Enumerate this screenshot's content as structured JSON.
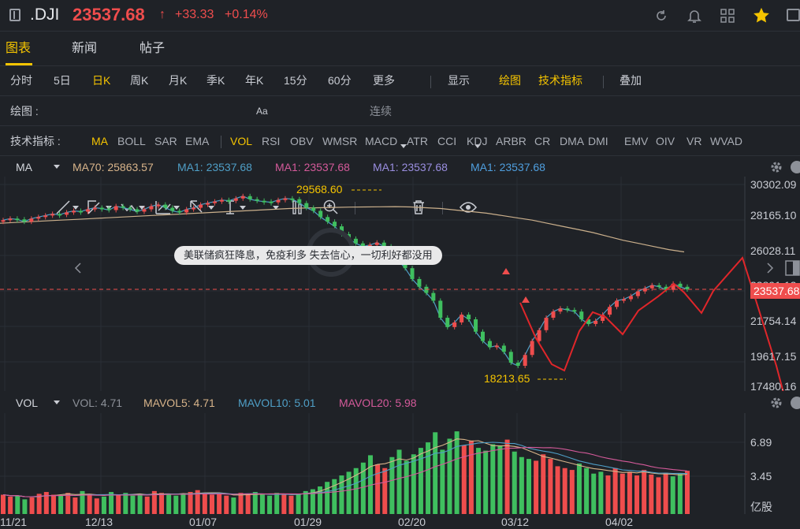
{
  "header": {
    "symbol": ".DJI",
    "price": "23537.68",
    "arrow": "↑",
    "change": "+33.33",
    "change_pct": "+0.14%",
    "icons": [
      "menu-icon",
      "refresh-icon",
      "bell-icon",
      "grid-icon",
      "star-icon",
      "more-icon"
    ]
  },
  "tabs": [
    "图表",
    "新闻",
    "帖子"
  ],
  "periods": [
    "分时",
    "5日",
    "日K",
    "周K",
    "月K",
    "季K",
    "年K",
    "15分",
    "60分",
    "更多"
  ],
  "period_right": [
    "显示",
    "绘图",
    "技术指标",
    "叠加"
  ],
  "drawbar": {
    "label": "绘图 :",
    "continuous": "连续"
  },
  "indicators": {
    "label": "技术指标 :",
    "items": [
      "MA",
      "BOLL",
      "SAR",
      "EMA",
      "VOL",
      "RSI",
      "OBV",
      "WMSR",
      "MACD",
      "ATR",
      "CCI",
      "KDJ",
      "ARBR",
      "CR",
      "DMA",
      "DMI",
      "EMV",
      "OIV",
      "VR",
      "WVAD"
    ]
  },
  "ma_legend": [
    "MA",
    "MA70: 25863.57",
    "MA1: 23537.68",
    "MA1: 23537.68",
    "MA1: 23537.68",
    "MA1: 23537.68"
  ],
  "vol_legend": [
    "VOL",
    "VOL: 4.71",
    "MAVOL5: 4.71",
    "MAVOL10: 5.01",
    "MAVOL20: 5.98"
  ],
  "price_axis": [
    "30302.09",
    "28165.10",
    "26028.11",
    "23891.12",
    "21754.14",
    "19617.15",
    "17480.16"
  ],
  "current_price_tag": "23537.68",
  "vol_axis": [
    "6.89",
    "3.45",
    "亿股"
  ],
  "dates": [
    "11/21",
    "12/13",
    "01/07",
    "01/29",
    "02/20",
    "03/12",
    "04/02"
  ],
  "annotations": {
    "high": "29568.60",
    "low": "18213.65",
    "comment": "美联储疯狂降息，免疫利多 失去信心，一切利好都没用"
  },
  "colors": {
    "up": "#ef4d4d",
    "down": "#3fbf5f",
    "gold": "#f5c400",
    "bg": "#1f2227"
  },
  "chart_data": {
    "type": "candlestick",
    "ylim": [
      17480.16,
      30302.09
    ],
    "x": [
      "11/21",
      "12/13",
      "01/07",
      "01/29",
      "02/20",
      "03/12",
      "04/02"
    ],
    "close_series": [
      28000,
      28100,
      28050,
      27900,
      28100,
      28200,
      28300,
      28400,
      28350,
      28500,
      28600,
      28550,
      28700,
      28800,
      28750,
      28650,
      28900,
      28800,
      28700,
      28550,
      28700,
      28900,
      29000,
      28800,
      28600,
      28500,
      28700,
      28800,
      29000,
      29100,
      29200,
      29300,
      29250,
      29400,
      29550,
      29350,
      29250,
      29200,
      29150,
      29300,
      29400,
      29350,
      29100,
      28800,
      28600,
      28200,
      27900,
      27600,
      27100,
      26800,
      26500,
      26300,
      26400,
      26550,
      26300,
      25800,
      25400,
      24900,
      24200,
      23700,
      23300,
      22800,
      21700,
      21100,
      21400,
      21900,
      21600,
      20800,
      20200,
      19800,
      19900,
      19500,
      18800,
      18600,
      19300,
      20200,
      20900,
      21700,
      22100,
      22300,
      22200,
      22100,
      21600,
      21300,
      21500,
      21900,
      22400,
      22800,
      22900,
      23100,
      23400,
      23600,
      23800,
      23700,
      23500,
      23900,
      23700,
      23537
    ],
    "ma70": [
      27800,
      27850,
      27900,
      27950,
      28000,
      28050,
      28100,
      28150,
      28200,
      28250,
      28300,
      28350,
      28400,
      28450,
      28500,
      28550,
      28600,
      28650,
      28700,
      28750,
      28780,
      28800,
      28820,
      28840,
      28850,
      28860,
      28870,
      28850,
      28800,
      28750,
      28650,
      28550,
      28450,
      28300,
      28150,
      28000,
      27800,
      27600,
      27400,
      27200,
      26950,
      26700,
      26500,
      26300,
      26100,
      25950
    ],
    "volume": [
      2.1,
      1.9,
      2.0,
      1.6,
      1.8,
      2.2,
      2.4,
      2.1,
      2.0,
      2.3,
      1.8,
      2.5,
      2.2,
      1.7,
      1.9,
      2.4,
      2.1,
      2.3,
      2.0,
      2.2,
      1.9,
      2.5,
      2.3,
      2.1,
      2.0,
      2.2,
      2.4,
      2.6,
      2.3,
      2.1,
      2.2,
      2.0,
      1.8,
      2.3,
      2.2,
      2.4,
      2.1,
      2.0,
      2.3,
      2.2,
      2.0,
      2.2,
      2.5,
      2.7,
      3.0,
      3.5,
      3.8,
      4.2,
      4.6,
      5.0,
      5.6,
      6.4,
      5.4,
      5.0,
      6.2,
      7.0,
      5.8,
      6.5,
      7.2,
      7.8,
      8.9,
      7.0,
      8.2,
      9.0,
      7.5,
      8.0,
      7.2,
      6.9,
      7.6,
      7.4,
      8.1,
      6.8,
      6.2,
      6.0,
      5.8,
      6.5,
      6.0,
      5.2,
      5.0,
      4.8,
      5.5,
      5.0,
      4.4,
      4.6,
      4.2,
      5.0,
      4.4,
      4.6,
      4.2,
      4.8,
      4.3,
      4.0,
      4.5,
      4.1,
      4.4,
      4.71
    ]
  }
}
